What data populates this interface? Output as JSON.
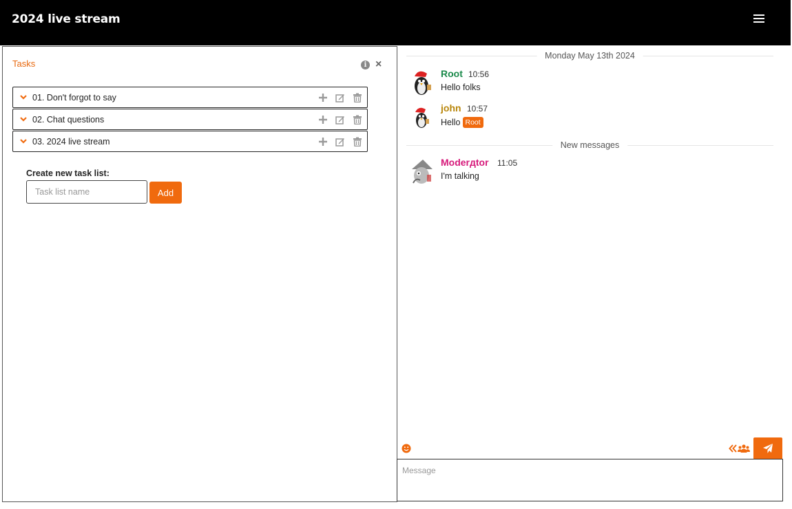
{
  "header": {
    "title": "2024 live stream",
    "menu_icon": "bars-icon"
  },
  "tasks_panel": {
    "title": "Tasks",
    "info_icon": "info-icon",
    "close_icon": "close-icon",
    "lists": [
      {
        "name": "01. Don't forgot to say"
      },
      {
        "name": "02. Chat questions"
      },
      {
        "name": "03. 2024 live stream"
      }
    ],
    "new_list": {
      "label": "Create new task list:",
      "placeholder": "Task list name",
      "add_label": "Add"
    }
  },
  "chat": {
    "date_divider": "Monday May 13th 2024",
    "new_divider": "New messages",
    "messages": [
      {
        "user": "Root",
        "time": "10:56",
        "text": "Hello folks",
        "color": "#1a8a4a"
      },
      {
        "user": "john",
        "time": "10:57",
        "text": "Hello",
        "mention": "Root",
        "color": "#b8860b"
      },
      {
        "user": "Moderдtor",
        "time": "11:05",
        "text": "I'm talking",
        "color": "#d6197a"
      }
    ],
    "input_placeholder": "Message"
  },
  "colors": {
    "accent": "#f06a0e",
    "topbar": "#000000"
  }
}
